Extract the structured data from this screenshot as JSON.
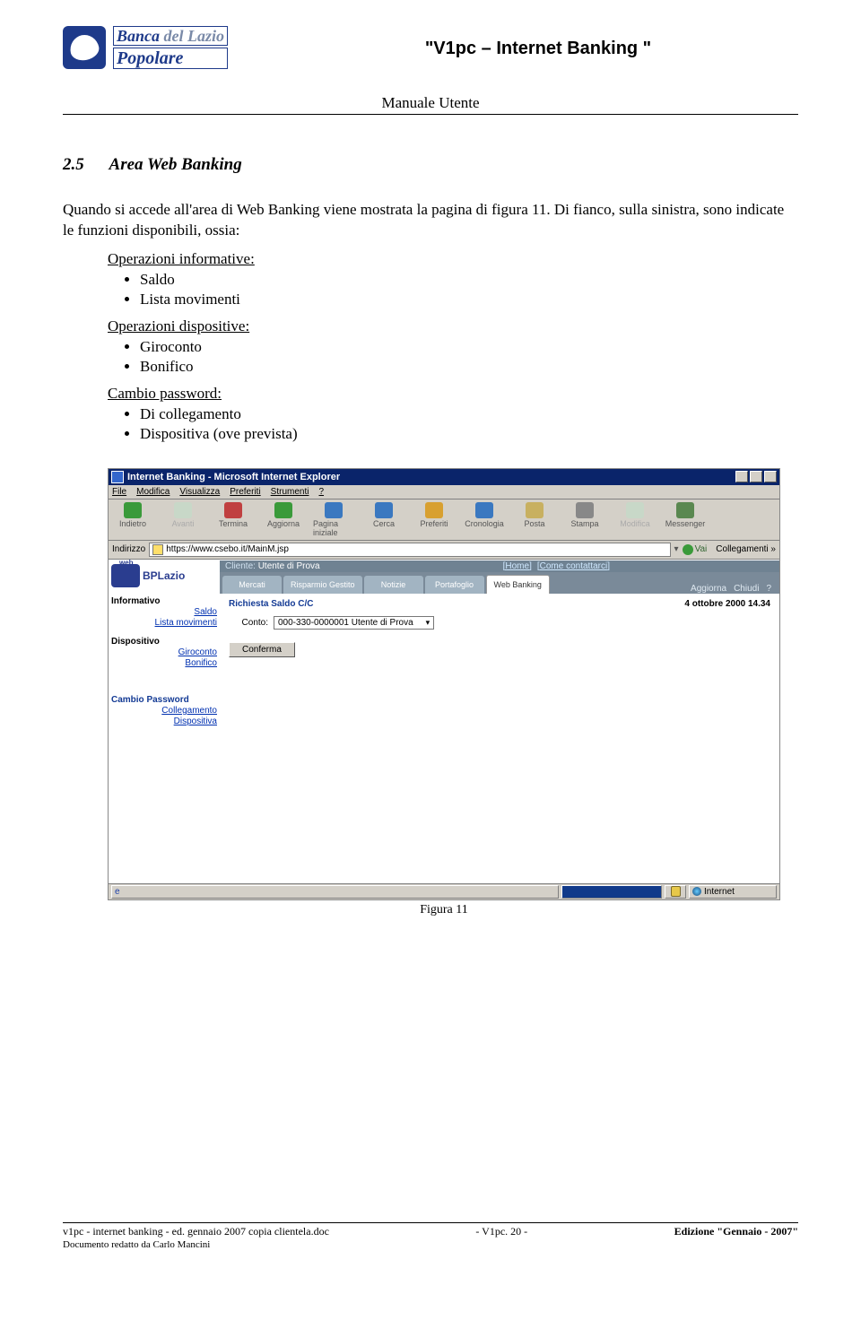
{
  "header": {
    "logo_line1a": "Banca",
    "logo_line1b": "del Lazio",
    "logo_line2": "Popolare",
    "title": "\"V1pc – Internet Banking \""
  },
  "subtitle": "Manuale Utente",
  "section": {
    "number": "2.5",
    "title": "Area Web Banking"
  },
  "body": {
    "p1": "Quando si accede all'area di Web Banking viene mostrata la pagina di figura 11. Di fianco, sulla sinistra, sono indicate le funzioni disponibili, ossia:",
    "g1_label": "Operazioni informative:",
    "g1_items": [
      "Saldo",
      "Lista movimenti"
    ],
    "g2_label": "Operazioni dispositive:",
    "g2_items": [
      "Giroconto",
      "Bonifico"
    ],
    "g3_label": "Cambio password:",
    "g3_items": [
      "Di collegamento",
      "Dispositiva (ove prevista)"
    ]
  },
  "screenshot": {
    "window_title": "Internet Banking - Microsoft Internet Explorer",
    "menu": [
      "File",
      "Modifica",
      "Visualizza",
      "Preferiti",
      "Strumenti",
      "?"
    ],
    "toolbar": [
      {
        "label": "Indietro",
        "color": "#3a9a3a"
      },
      {
        "label": "Avanti",
        "color": "#c8d8c8",
        "disabled": true
      },
      {
        "label": "Termina",
        "color": "#c04040"
      },
      {
        "label": "Aggiorna",
        "color": "#3a9a3a"
      },
      {
        "label": "Pagina iniziale",
        "color": "#3a78c0"
      },
      {
        "label": "Cerca",
        "color": "#3a78c0"
      },
      {
        "label": "Preferiti",
        "color": "#d8a030"
      },
      {
        "label": "Cronologia",
        "color": "#3a78c0"
      },
      {
        "label": "Posta",
        "color": "#c8b060"
      },
      {
        "label": "Stampa",
        "color": "#888"
      },
      {
        "label": "Modifica",
        "color": "#c8d8c8",
        "disabled": true
      },
      {
        "label": "Messenger",
        "color": "#5a8850"
      }
    ],
    "addr_label": "Indirizzo",
    "addr_url": "https://www.csebo.it/MainM.jsp",
    "go_label": "Vai",
    "links_label": "Collegamenti »",
    "strip_client_label": "Cliente:",
    "strip_client_value": "Utente di Prova",
    "strip_home": "[Home]",
    "strip_contact": "[Come contattarci]",
    "tabs": [
      "Mercati",
      "Risparmio Gestito",
      "Notizie",
      "Portafoglio",
      "Web Banking"
    ],
    "right_actions": [
      "Aggiorna",
      "Chiudi",
      "?"
    ],
    "side": {
      "brand": "BPLazio",
      "g1": {
        "h": "Informativo",
        "items": [
          "Saldo",
          "Lista movimenti"
        ]
      },
      "g2": {
        "h": "Dispositivo",
        "items": [
          "Giroconto",
          "Bonifico"
        ]
      },
      "g3": {
        "h": "Cambio Password",
        "items": [
          "Collegamento",
          "Dispositiva"
        ]
      }
    },
    "main": {
      "title": "Richiesta Saldo C/C",
      "datetime": "4 ottobre 2000 14.34",
      "field_label": "Conto:",
      "field_value": "000-330-0000001 Utente di Prova",
      "confirm": "Conferma"
    },
    "status": {
      "done_icon": "e",
      "internet": "Internet"
    },
    "caption": "Figura 11"
  },
  "footer": {
    "left": "v1pc - internet banking - ed. gennaio 2007 copia clientela.doc",
    "center": "- V1pc. 20 -",
    "right": "Edizione \"Gennaio - 2007\"",
    "author": "Documento redatto da Carlo Mancini"
  }
}
